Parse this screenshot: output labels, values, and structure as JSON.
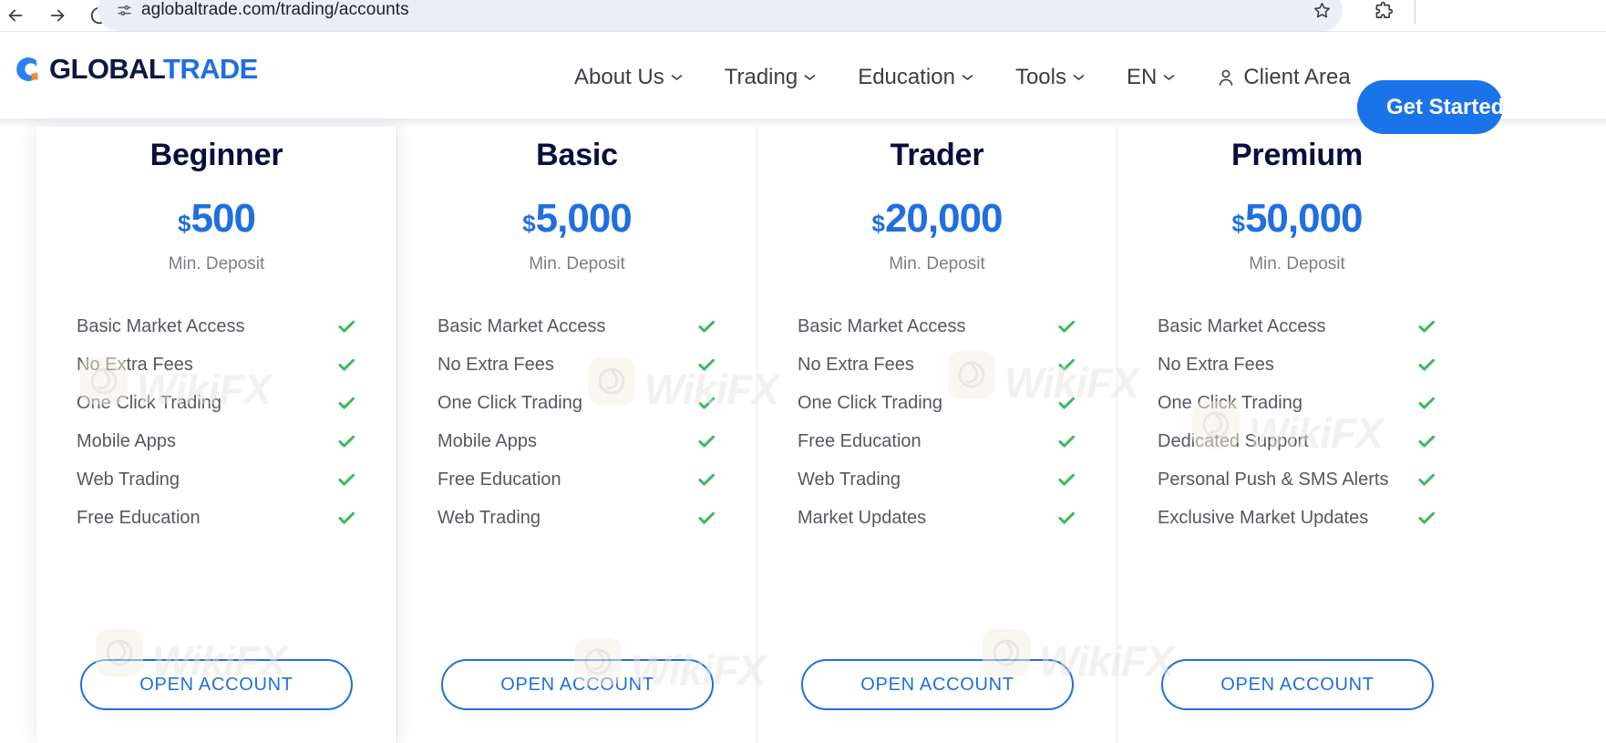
{
  "browser": {
    "url": "aglobaltrade.com/trading/accounts",
    "back_icon": "back-arrow-icon",
    "forward_icon": "forward-arrow-icon",
    "reload_icon": "reload-icon",
    "site_info_icon": "site-settings-icon",
    "bookmark_icon": "bookmark-star-icon",
    "extension_icon": "browser-extension-icon"
  },
  "site_header": {
    "logo": {
      "part1": "GLOBAL",
      "part2": "TRADE",
      "mark_icon": "c-logomark-icon"
    },
    "nav": [
      {
        "label": "About Us",
        "has_caret": true
      },
      {
        "label": "Trading",
        "has_caret": true
      },
      {
        "label": "Education",
        "has_caret": true
      },
      {
        "label": "Tools",
        "has_caret": true
      },
      {
        "label": "EN",
        "has_caret": true
      }
    ],
    "client_area": {
      "label": "Client Area",
      "icon": "user-account-icon"
    },
    "cta": {
      "label": "Get Started"
    },
    "colors": {
      "accent": "#1a73e8",
      "logo_dark": "#0d1744",
      "logo_blue": "#1f6fe0"
    }
  },
  "pricing": {
    "button_label": "OPEN ACCOUNT",
    "deposit_label": "Min. Deposit",
    "currency": "$",
    "check_color": "#3cb95f",
    "cards": [
      {
        "title": "Beginner",
        "price": "500",
        "features": [
          "Basic Market Access",
          "No Extra Fees",
          "One Click Trading",
          "Mobile Apps",
          "Web Trading",
          "Free Education"
        ]
      },
      {
        "title": "Basic",
        "price": "5,000",
        "features": [
          "Basic Market Access",
          "No Extra Fees",
          "One Click Trading",
          "Mobile Apps",
          "Free Education",
          "Web Trading"
        ]
      },
      {
        "title": "Trader",
        "price": "20,000",
        "features": [
          "Basic Market Access",
          "No Extra Fees",
          "One Click Trading",
          "Free Education",
          "Web Trading",
          "Market Updates"
        ]
      },
      {
        "title": "Premium",
        "price": "50,000",
        "features": [
          "Basic Market Access",
          "No Extra Fees",
          "One Click Trading",
          "Dedicated Support",
          "Personal Push & SMS Alerts",
          "Exclusive Market Updates"
        ]
      }
    ]
  },
  "watermark": {
    "text": "WikiFX"
  }
}
